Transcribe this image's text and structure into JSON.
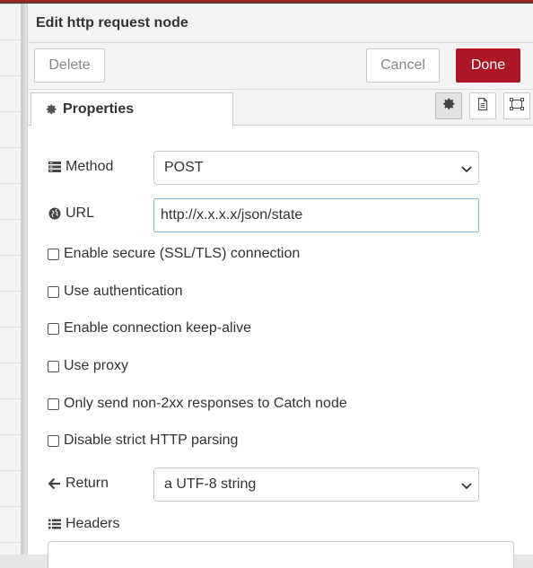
{
  "tray": {
    "title": "Edit http request node"
  },
  "toolbar": {
    "delete_label": "Delete",
    "cancel_label": "Cancel",
    "done_label": "Done"
  },
  "tabs": {
    "properties_label": "Properties",
    "icons": [
      "gear-icon",
      "description-icon",
      "appearance-icon"
    ]
  },
  "form": {
    "method": {
      "label": "Method",
      "value": "POST"
    },
    "url": {
      "label": "URL",
      "value": "http://x.x.x.x/json/state"
    },
    "checkboxes": [
      {
        "label": "Enable secure (SSL/TLS) connection",
        "checked": false
      },
      {
        "label": "Use authentication",
        "checked": false
      },
      {
        "label": "Enable connection keep-alive",
        "checked": false
      },
      {
        "label": "Use proxy",
        "checked": false
      },
      {
        "label": "Only send non-2xx responses to Catch node",
        "checked": false
      },
      {
        "label": "Disable strict HTTP parsing",
        "checked": false
      }
    ],
    "return": {
      "label": "Return",
      "value": "a UTF-8 string"
    },
    "headers": {
      "label": "Headers"
    }
  },
  "colors": {
    "done_button": "#ad1625",
    "url_focus_border": "#85b7d9",
    "top_accent": "#a2202a"
  }
}
